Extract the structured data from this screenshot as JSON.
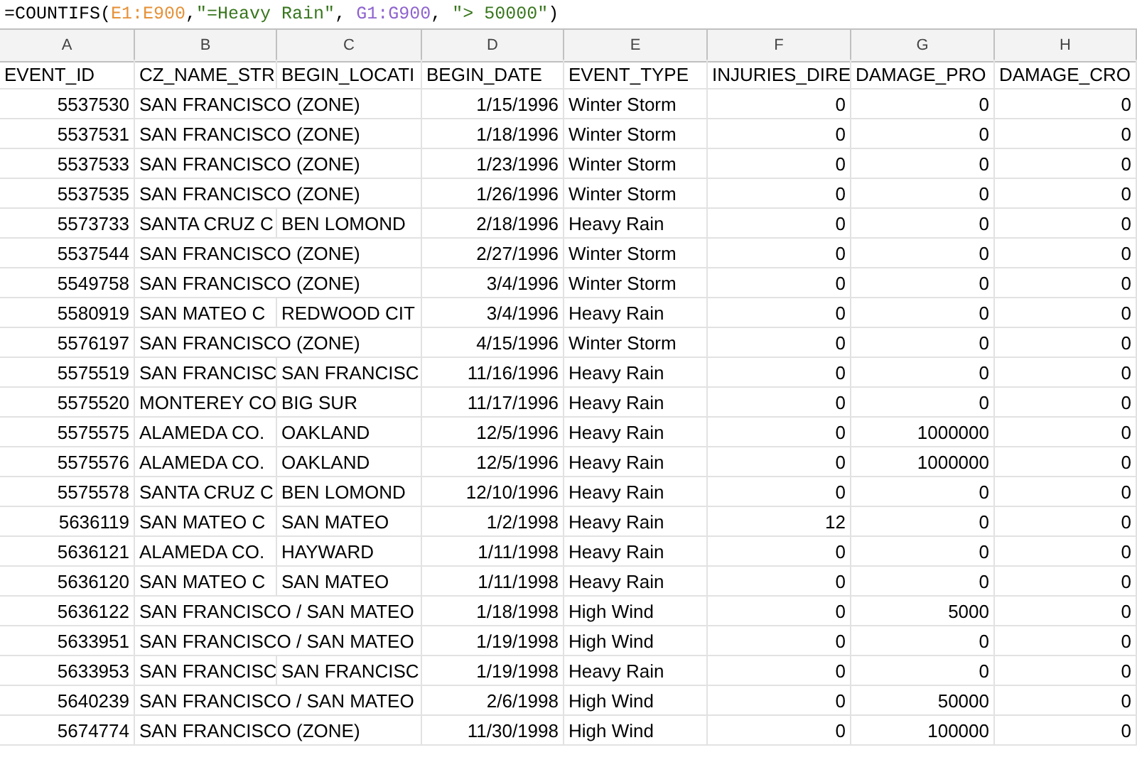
{
  "formula_bar": {
    "tokens": [
      {
        "text": "=COUNTIFS("
      },
      {
        "text": "E1:E900",
        "color": "#e69138"
      },
      {
        "text": ","
      },
      {
        "text": "\"=Heavy Rain\"",
        "color": "#38761d"
      },
      {
        "text": ", "
      },
      {
        "text": "G1:G900",
        "color": "#8e63ce"
      },
      {
        "text": ", "
      },
      {
        "text": "\"> 50000\"",
        "color": "#38761d"
      },
      {
        "text": ")"
      }
    ]
  },
  "column_letters": [
    "A",
    "B",
    "C",
    "D",
    "E",
    "F",
    "G",
    "H"
  ],
  "header_row": [
    "EVENT_ID",
    "CZ_NAME_STR",
    "BEGIN_LOCATI",
    "BEGIN_DATE",
    "EVENT_TYPE",
    "INJURIES_DIRE",
    "DAMAGE_PRO",
    "DAMAGE_CRO"
  ],
  "rows": [
    {
      "event_id": "5537530",
      "cz_name": "SAN FRANCISCO (ZONE)",
      "begin_date": "1/15/1996",
      "event_type": "Winter Storm",
      "injuries": "0",
      "damage_property": "0",
      "damage_crops": "0"
    },
    {
      "event_id": "5537531",
      "cz_name": "SAN FRANCISCO (ZONE)",
      "begin_date": "1/18/1996",
      "event_type": "Winter Storm",
      "injuries": "0",
      "damage_property": "0",
      "damage_crops": "0"
    },
    {
      "event_id": "5537533",
      "cz_name": "SAN FRANCISCO (ZONE)",
      "begin_date": "1/23/1996",
      "event_type": "Winter Storm",
      "injuries": "0",
      "damage_property": "0",
      "damage_crops": "0"
    },
    {
      "event_id": "5537535",
      "cz_name": "SAN FRANCISCO (ZONE)",
      "begin_date": "1/26/1996",
      "event_type": "Winter Storm",
      "injuries": "0",
      "damage_property": "0",
      "damage_crops": "0"
    },
    {
      "event_id": "5573733",
      "cz_name": "SANTA CRUZ C",
      "begin_location": "BEN LOMOND",
      "begin_date": "2/18/1996",
      "event_type": "Heavy Rain",
      "injuries": "0",
      "damage_property": "0",
      "damage_crops": "0"
    },
    {
      "event_id": "5537544",
      "cz_name": "SAN FRANCISCO (ZONE)",
      "begin_date": "2/27/1996",
      "event_type": "Winter Storm",
      "injuries": "0",
      "damage_property": "0",
      "damage_crops": "0"
    },
    {
      "event_id": "5549758",
      "cz_name": "SAN FRANCISCO (ZONE)",
      "begin_date": "3/4/1996",
      "event_type": "Winter Storm",
      "injuries": "0",
      "damage_property": "0",
      "damage_crops": "0"
    },
    {
      "event_id": "5580919",
      "cz_name": "SAN MATEO C",
      "begin_location": "REDWOOD CIT",
      "begin_date": "3/4/1996",
      "event_type": "Heavy Rain",
      "injuries": "0",
      "damage_property": "0",
      "damage_crops": "0"
    },
    {
      "event_id": "5576197",
      "cz_name": "SAN FRANCISCO (ZONE)",
      "begin_date": "4/15/1996",
      "event_type": "Winter Storm",
      "injuries": "0",
      "damage_property": "0",
      "damage_crops": "0"
    },
    {
      "event_id": "5575519",
      "cz_name": "SAN FRANCISC",
      "begin_location": "SAN FRANCISC",
      "begin_date": "11/16/1996",
      "event_type": "Heavy Rain",
      "injuries": "0",
      "damage_property": "0",
      "damage_crops": "0"
    },
    {
      "event_id": "5575520",
      "cz_name": "MONTEREY CO",
      "begin_location": "BIG SUR",
      "begin_date": "11/17/1996",
      "event_type": "Heavy Rain",
      "injuries": "0",
      "damage_property": "0",
      "damage_crops": "0"
    },
    {
      "event_id": "5575575",
      "cz_name": "ALAMEDA CO.",
      "begin_location": "OAKLAND",
      "begin_date": "12/5/1996",
      "event_type": "Heavy Rain",
      "injuries": "0",
      "damage_property": "1000000",
      "damage_crops": "0"
    },
    {
      "event_id": "5575576",
      "cz_name": "ALAMEDA CO.",
      "begin_location": "OAKLAND",
      "begin_date": "12/5/1996",
      "event_type": "Heavy Rain",
      "injuries": "0",
      "damage_property": "1000000",
      "damage_crops": "0"
    },
    {
      "event_id": "5575578",
      "cz_name": "SANTA CRUZ C",
      "begin_location": "BEN LOMOND",
      "begin_date": "12/10/1996",
      "event_type": "Heavy Rain",
      "injuries": "0",
      "damage_property": "0",
      "damage_crops": "0"
    },
    {
      "event_id": "5636119",
      "cz_name": "SAN MATEO C",
      "begin_location": "SAN MATEO",
      "begin_date": "1/2/1998",
      "event_type": "Heavy Rain",
      "injuries": "12",
      "damage_property": "0",
      "damage_crops": "0"
    },
    {
      "event_id": "5636121",
      "cz_name": "ALAMEDA CO.",
      "begin_location": "HAYWARD",
      "begin_date": "1/11/1998",
      "event_type": "Heavy Rain",
      "injuries": "0",
      "damage_property": "0",
      "damage_crops": "0"
    },
    {
      "event_id": "5636120",
      "cz_name": "SAN MATEO C",
      "begin_location": "SAN MATEO",
      "begin_date": "1/11/1998",
      "event_type": "Heavy Rain",
      "injuries": "0",
      "damage_property": "0",
      "damage_crops": "0"
    },
    {
      "event_id": "5636122",
      "cz_name": "SAN FRANCISCO / SAN MATEO",
      "begin_date": "1/18/1998",
      "event_type": "High Wind",
      "injuries": "0",
      "damage_property": "5000",
      "damage_crops": "0"
    },
    {
      "event_id": "5633951",
      "cz_name": "SAN FRANCISCO / SAN MATEO",
      "begin_date": "1/19/1998",
      "event_type": "High Wind",
      "injuries": "0",
      "damage_property": "0",
      "damage_crops": "0"
    },
    {
      "event_id": "5633953",
      "cz_name": "SAN FRANCISC",
      "begin_location": "SAN FRANCISC",
      "begin_date": "1/19/1998",
      "event_type": "Heavy Rain",
      "injuries": "0",
      "damage_property": "0",
      "damage_crops": "0"
    },
    {
      "event_id": "5640239",
      "cz_name": "SAN FRANCISCO / SAN MATEO",
      "begin_date": "2/6/1998",
      "event_type": "High Wind",
      "injuries": "0",
      "damage_property": "50000",
      "damage_crops": "0"
    },
    {
      "event_id": "5674774",
      "cz_name": "SAN FRANCISCO (ZONE)",
      "begin_date": "11/30/1998",
      "event_type": "High Wind",
      "injuries": "0",
      "damage_property": "100000",
      "damage_crops": "0"
    }
  ]
}
